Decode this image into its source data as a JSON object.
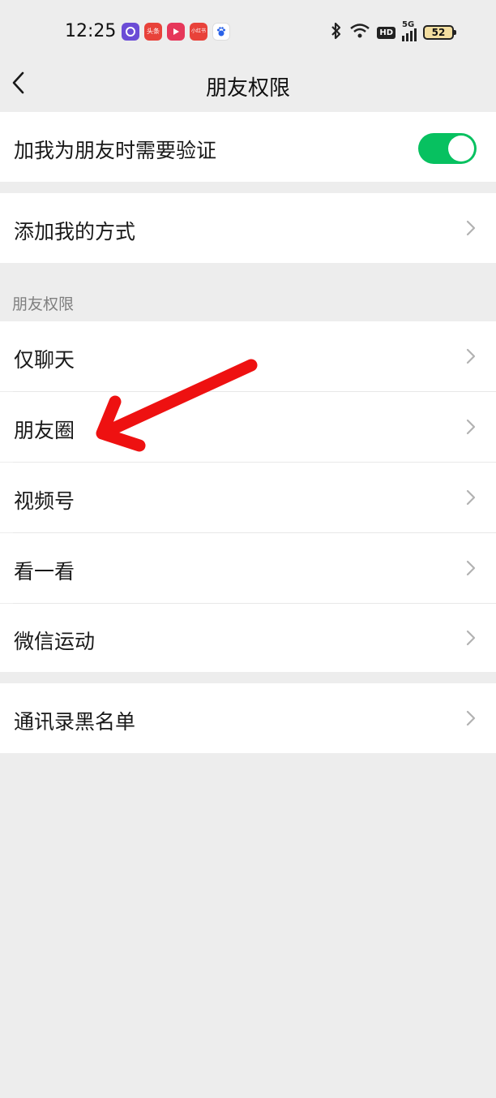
{
  "status_bar": {
    "time": "12:25",
    "app_icons": [
      {
        "name": "circle-app-icon",
        "text": "",
        "color": "#6b4cd6"
      },
      {
        "name": "toutiao-app-icon",
        "text": "头条",
        "color": "#e8423a"
      },
      {
        "name": "video-app-icon",
        "text": "",
        "color": "#e6375a"
      },
      {
        "name": "shop-app-icon",
        "text": "小红书",
        "color": "#e8423a"
      },
      {
        "name": "baidu-app-icon",
        "text": "",
        "color": "#2a62e8"
      }
    ],
    "network": "5G",
    "hd_label": "HD",
    "battery": "52"
  },
  "nav": {
    "title": "朋友权限",
    "back_icon": "chevron-left-icon"
  },
  "settings": {
    "verify_label": "加我为朋友时需要验证",
    "verify_enabled": true,
    "add_method_label": "添加我的方式",
    "section_header": "朋友权限",
    "permissions": [
      {
        "label": "仅聊天"
      },
      {
        "label": "朋友圈"
      },
      {
        "label": "视频号"
      },
      {
        "label": "看一看"
      },
      {
        "label": "微信运动"
      }
    ],
    "blacklist_label": "通讯录黑名单"
  },
  "colors": {
    "toggle_on": "#07c160",
    "background": "#ededed",
    "annotation_arrow": "#ee1111"
  }
}
